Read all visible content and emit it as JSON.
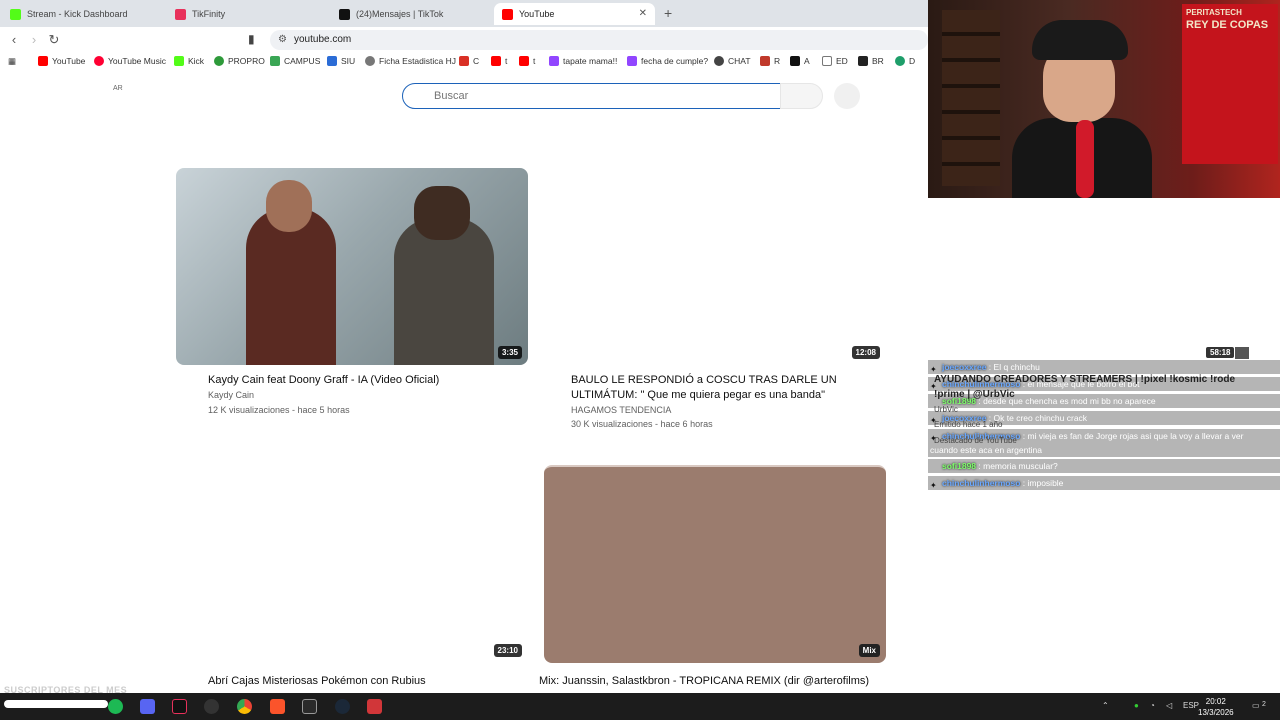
{
  "browser": {
    "tabs": [
      {
        "label": "Stream - Kick Dashboard",
        "fav": "#53fc18"
      },
      {
        "label": "TikFinity",
        "fav": "#e8315b"
      },
      {
        "label": "(24)Mensajes | TikTok",
        "fav": "#111111"
      },
      {
        "label": "YouTube",
        "fav": "#ff0000"
      }
    ],
    "close_glyph": "✕",
    "new_tab_glyph": "+",
    "url": "youtube.com",
    "bookmarks": [
      {
        "label": "YouTube",
        "color": "#ff0000"
      },
      {
        "label": "YouTube Music",
        "color": "#ff0033"
      },
      {
        "label": "Kick",
        "color": "#53fc18"
      },
      {
        "label": "PROPRO",
        "color": "#2e9a3a"
      },
      {
        "label": "CAMPUS",
        "color": "#3aa655"
      },
      {
        "label": "SIU",
        "color": "#2b6cd6"
      },
      {
        "label": "Ficha Estadistica HJ",
        "color": "#777777"
      },
      {
        "label": "C",
        "color": "#d93025"
      },
      {
        "label": "t",
        "color": "#ff0000"
      },
      {
        "label": "t",
        "color": "#ff0000"
      },
      {
        "label": "tapate mama!!",
        "color": "#9146ff"
      },
      {
        "label": "fecha de cumple?",
        "color": "#9146ff"
      },
      {
        "label": "CHAT",
        "color": "#444444"
      },
      {
        "label": "R",
        "color": "#c0392b"
      },
      {
        "label": "A",
        "color": "#111111"
      },
      {
        "label": "ED",
        "color": "#999999"
      },
      {
        "label": "BR",
        "color": "#222222"
      },
      {
        "label": "D",
        "color": "#1e9e6a"
      }
    ]
  },
  "youtube": {
    "country_code": "AR",
    "search_placeholder": "Buscar",
    "videos": [
      {
        "title": "Kaydy Cain feat Doony Graff - IA (Video Oficial)",
        "channel": "Kaydy Cain",
        "meta": "12 K visualizaciones - hace 5 horas",
        "duration": "3:35"
      },
      {
        "title": "BAULO LE RESPONDIÓ a COSCU TRAS DARLE UN ULTIMÁTUM: \" Que me quiera pegar es una banda\"",
        "channel": "HAGAMOS TENDENCIA",
        "meta": "30 K visualizaciones - hace 6 horas",
        "duration": "12:08"
      },
      {
        "title": "Abrí Cajas Misteriosas Pokémon con Rubius",
        "duration": "23:10"
      },
      {
        "title": "Mix: Juanssin, Salastkbron - TROPICANA REMIX  (dir @arterofilms)",
        "duration": "Mix"
      }
    ]
  },
  "stream": {
    "poster_text": "REY DE COPAS",
    "poster_brand": "PERITASTECH",
    "viewers": "58:18",
    "chat": [
      {
        "user": "joecoxxree",
        "msg": ": El q chinchu",
        "color": "#6aa8ff"
      },
      {
        "user": "chinchulinhermoso",
        "msg": ": el mensaje que le borro el bot",
        "color": "#6aa8ff"
      },
      {
        "user": "sofi1898",
        "msg": ": desde que chencha es mod mi bb no aparece",
        "color": "#7dff6a"
      },
      {
        "user": "joecoxxree",
        "msg": ": Ok te creo chinchu crack",
        "color": "#6aa8ff"
      },
      {
        "user": "chinchulinhermoso",
        "msg": ": mi vieja es fan de Jorge rojas asi que la voy a llevar a ver",
        "color": "#6aa8ff"
      },
      {
        "user": "",
        "msg": "cuando este aca en argentina",
        "color": "#ffffff"
      },
      {
        "user": "sofi1898",
        "msg": ": memoria muscular?",
        "color": "#7dff6a"
      },
      {
        "user": "chinchulinhermoso",
        "msg": ": imposible",
        "color": "#6aa8ff"
      }
    ],
    "ghost_lines": [
      "AYUDANDO CREADORES Y STREAMERS | !pixel !kosmic !rode",
      "!prime | @UrbVic",
      "UrbVic",
      "Emitido hace 1 año",
      "Destacado de YouTube"
    ],
    "overlay_subs": "SUSCRIPTORES DEL MES"
  },
  "taskbar": {
    "lang": "ESP",
    "time": "20:02",
    "date": "13/3/2026",
    "notif": "2"
  }
}
